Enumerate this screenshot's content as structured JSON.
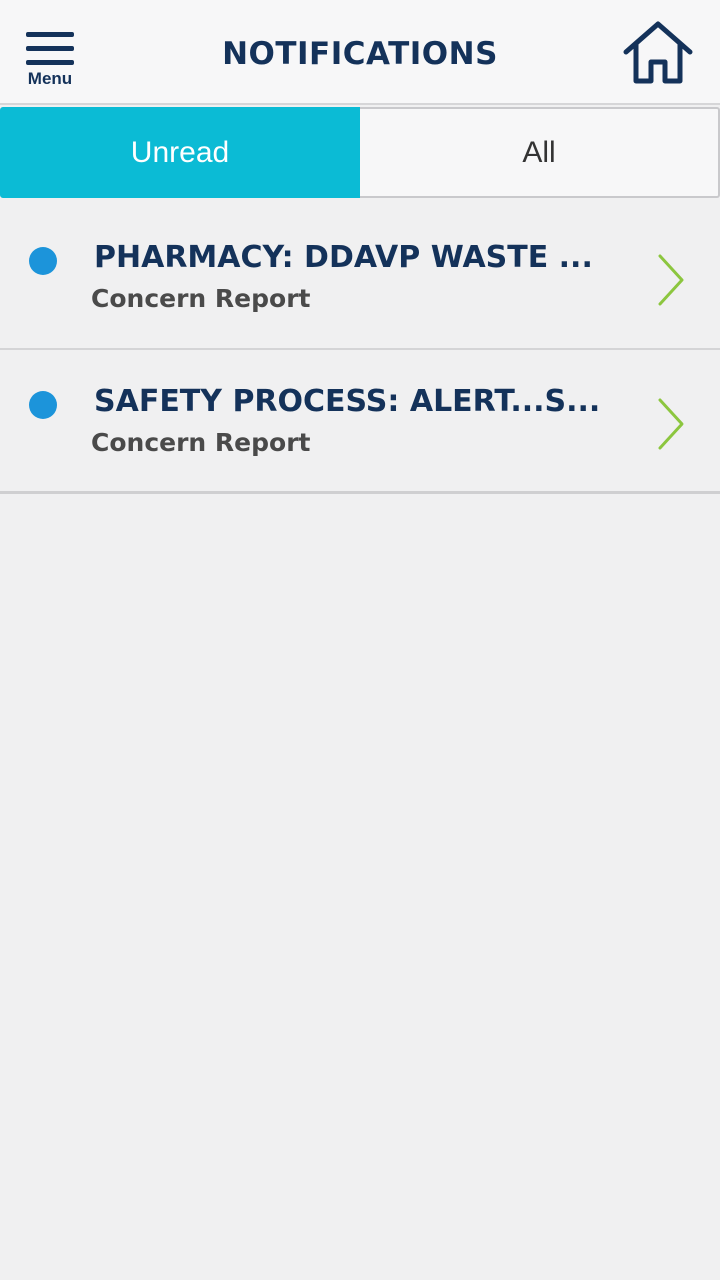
{
  "header": {
    "menu_label": "Menu",
    "title": "NOTIFICATIONS",
    "menu_icon": "hamburger-menu-icon",
    "home_icon": "home-icon"
  },
  "tabs": [
    {
      "label": "Unread",
      "selected": true
    },
    {
      "label": "All",
      "selected": false
    }
  ],
  "notifications": [
    {
      "title": "PHARMACY: DDAVP WASTE ...",
      "subtitle": "Concern Report",
      "unread": true
    },
    {
      "title": "SAFETY PROCESS: ALERT...S...",
      "subtitle": "Concern Report",
      "unread": true
    }
  ],
  "colors": {
    "brand_navy": "#14325a",
    "tab_active": "#0bbbd5",
    "unread_dot": "#1c94da",
    "chevron": "#8cc63f",
    "background": "#f0f0f1"
  }
}
